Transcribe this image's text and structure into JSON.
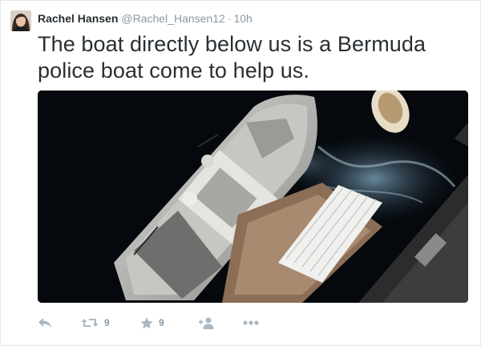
{
  "tweet": {
    "author_name": "Rachel Hansen",
    "author_handle": "@Rachel_Hansen12",
    "separator": "·",
    "time": "10h",
    "text": "The boat directly below us is a Bermuda police boat come to help us."
  },
  "actions": {
    "reply_icon": "reply-icon",
    "retweet_icon": "retweet-icon",
    "retweet_count": "9",
    "favorite_icon": "star-icon",
    "favorite_count": "9",
    "follow_icon": "follow-icon",
    "more_icon": "more-icon"
  },
  "colors": {
    "text": "#292f33",
    "muted": "#8899a6",
    "action_icon": "#aab8c2",
    "water": "#05080c"
  }
}
